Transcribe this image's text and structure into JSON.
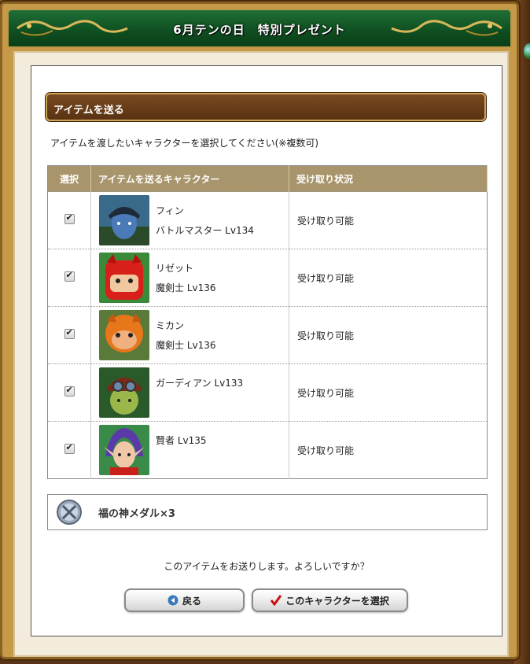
{
  "window": {
    "title": "6月テンの日　特別プレゼント"
  },
  "section": {
    "heading": "アイテムを送る",
    "instruction": "アイテムを渡したいキャラクターを選択してください(※複数可)"
  },
  "table": {
    "headers": {
      "select": "選択",
      "character": "アイテムを送るキャラクター",
      "status": "受け取り状況"
    },
    "rows": [
      {
        "checked": true,
        "name": "フィン",
        "job": "バトルマスター Lv134",
        "status": "受け取り可能",
        "avatar": "avatar-blue-hood"
      },
      {
        "checked": true,
        "name": "リゼット",
        "job": "魔剣士 Lv136",
        "status": "受け取り可能",
        "avatar": "avatar-red-puppet"
      },
      {
        "checked": true,
        "name": "ミカン",
        "job": "魔剣士 Lv136",
        "status": "受け取り可能",
        "avatar": "avatar-orange-cat"
      },
      {
        "checked": true,
        "name": "",
        "job": "ガーディアン Lv133",
        "status": "受け取り可能",
        "avatar": "avatar-goggles-dwarf"
      },
      {
        "checked": true,
        "name": "",
        "job": "賢者 Lv135",
        "status": "受け取り可能",
        "avatar": "avatar-purple-hair-elf"
      }
    ]
  },
  "item": {
    "label": "福の神メダル×3",
    "icon": "medal-icon"
  },
  "confirm_text": "このアイテムをお送りします。よろしいですか？",
  "buttons": {
    "back": "戻る",
    "select": "このキャラクターを選択"
  },
  "colors": {
    "title_green": "#1f6e36",
    "header_brown": "#5a3212",
    "table_header": "#a8956b"
  }
}
